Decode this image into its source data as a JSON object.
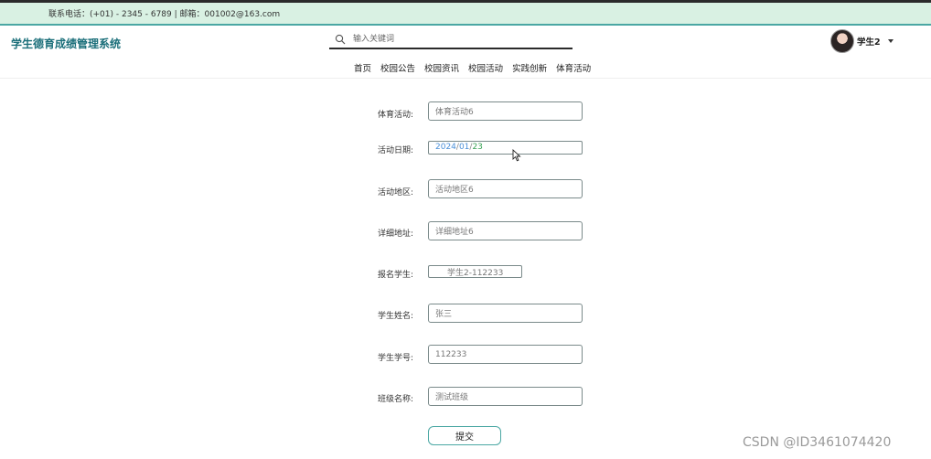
{
  "topbar": {
    "contact": "联系电话：(+01) - 2345 - 6789 | 邮箱：001002@163.com"
  },
  "header": {
    "site_title": "学生德育成绩管理系统",
    "search_placeholder": "输入关键词",
    "user_name": "学生2"
  },
  "nav": {
    "items": [
      {
        "label": "首页"
      },
      {
        "label": "校园公告"
      },
      {
        "label": "校园资讯"
      },
      {
        "label": "校园活动"
      },
      {
        "label": "实践创新"
      },
      {
        "label": "体育活动"
      }
    ]
  },
  "form": {
    "activity_label": "体育活动:",
    "activity_value": "体育活动6",
    "date_label": "活动日期:",
    "date_year": "2024",
    "date_month": "01",
    "date_day": "23",
    "date_sep": "/",
    "area_label": "活动地区:",
    "area_value": "活动地区6",
    "address_label": "详细地址:",
    "address_value": "详细地址6",
    "signup_label": "报名学生:",
    "signup_value": "学生2-112233",
    "name_label": "学生姓名:",
    "name_value": "张三",
    "number_label": "学生学号:",
    "number_value": "112233",
    "class_label": "班级名称:",
    "class_value": "测试班级",
    "submit_label": "提交"
  },
  "watermark": "CSDN @ID3461074420"
}
